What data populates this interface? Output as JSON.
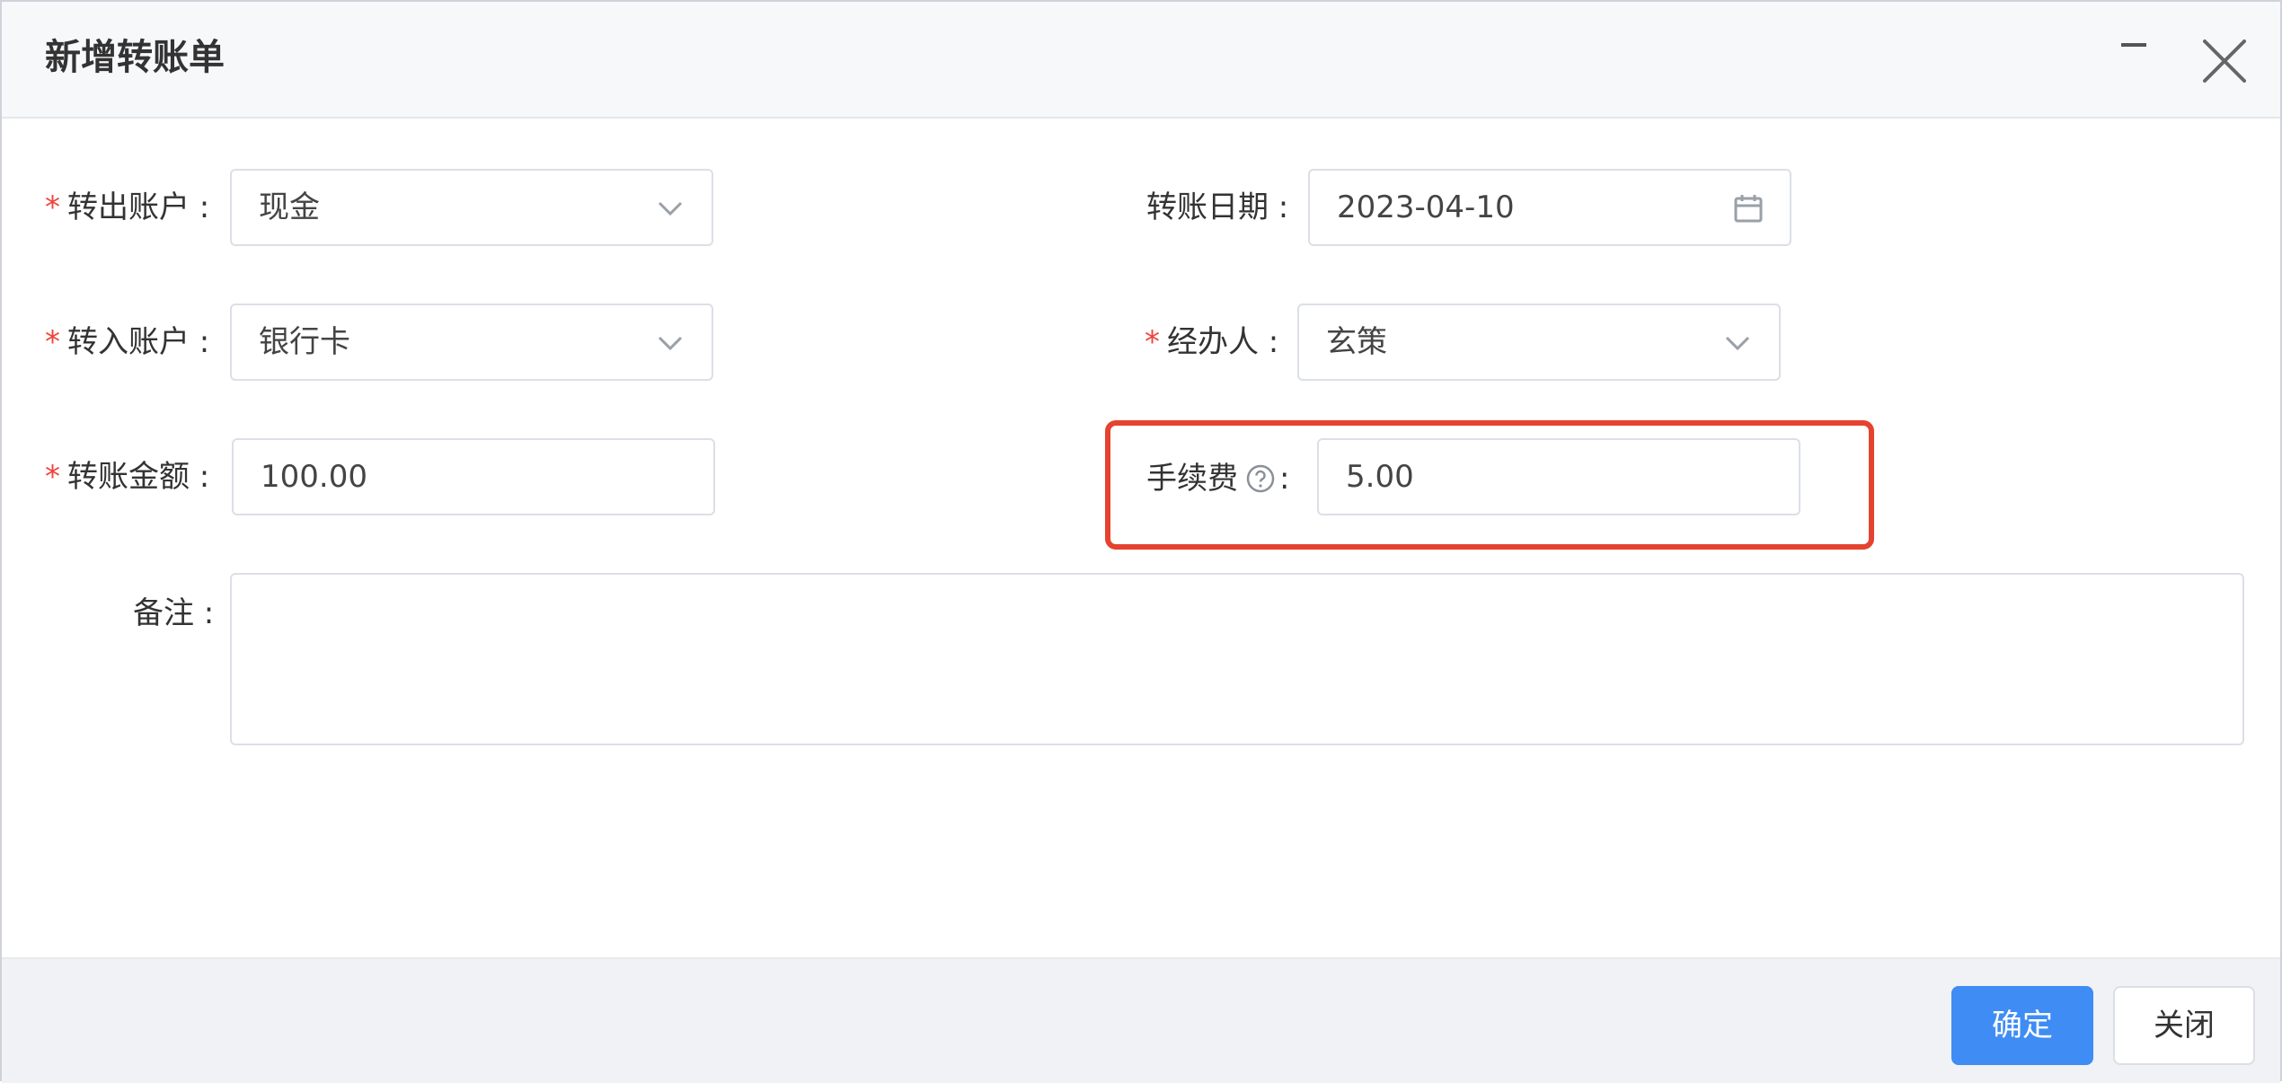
{
  "dialog": {
    "title": "新增转账单"
  },
  "form": {
    "from_account": {
      "required_mark": "*",
      "label": "转出账户 :",
      "value": "现金"
    },
    "transfer_date": {
      "label": "转账日期 :",
      "value": "2023-04-10"
    },
    "to_account": {
      "required_mark": "*",
      "label": "转入账户 :",
      "value": "银行卡"
    },
    "handler": {
      "required_mark": "*",
      "label": "经办人 :",
      "value": "玄策"
    },
    "amount": {
      "required_mark": "*",
      "label": "转账金额 :",
      "value": "100.00"
    },
    "fee": {
      "label": "手续费",
      "colon": ":",
      "value": "5.00"
    },
    "remark": {
      "label": "备注 :",
      "value": ""
    }
  },
  "footer": {
    "confirm_label": "确定",
    "close_label": "关闭"
  },
  "colors": {
    "primary": "#3f8cf5",
    "required": "#f0433a",
    "highlight": "#e5432f"
  },
  "icons": [
    "minimize-icon",
    "close-icon",
    "chevron-down-icon",
    "calendar-icon",
    "help-circle-icon"
  ]
}
